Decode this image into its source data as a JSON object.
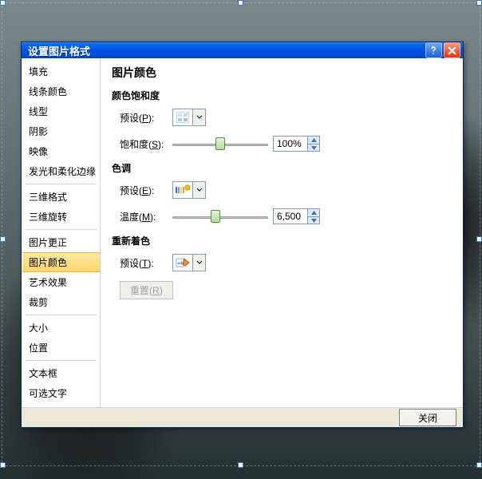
{
  "dialog": {
    "title": "设置图片格式"
  },
  "sidebar": {
    "items": [
      "填充",
      "线条颜色",
      "线型",
      "阴影",
      "映像",
      "发光和柔化边缘",
      "三维格式",
      "三维旋转",
      "图片更正",
      "图片颜色",
      "艺术效果",
      "裁剪",
      "大小",
      "位置",
      "文本框",
      "可选文字"
    ],
    "selectedIndex": 9
  },
  "content": {
    "heading": "图片颜色",
    "saturation": {
      "heading": "颜色饱和度",
      "preset_label": "预设",
      "preset_key": "P",
      "value_label": "饱和度",
      "value_key": "S",
      "value": "100%",
      "slider_percent": 50
    },
    "tone": {
      "heading": "色调",
      "preset_label": "预设",
      "preset_key": "E",
      "value_label": "温度",
      "value_key": "M",
      "value": "6,500",
      "slider_percent": 45
    },
    "recolor": {
      "heading": "重新着色",
      "preset_label": "预设",
      "preset_key": "T"
    },
    "reset_label": "重置",
    "reset_key": "R"
  },
  "footer": {
    "close_label": "关闭"
  }
}
